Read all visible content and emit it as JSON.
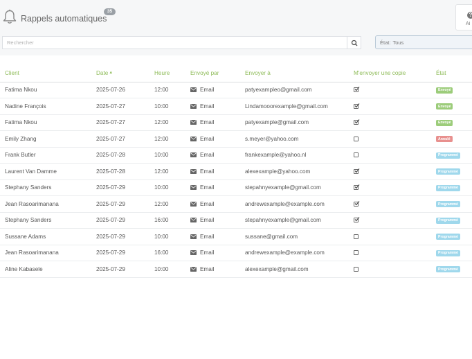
{
  "header": {
    "title": "Rappels automatiques",
    "count": "35",
    "help_label": "Ai"
  },
  "toolbar": {
    "search_placeholder": "Rechercher",
    "state_filter_label": "État:",
    "state_filter_value": "Tous"
  },
  "table": {
    "columns": {
      "client": "Client",
      "date": "Date",
      "date_sort": "▲",
      "heure": "Heure",
      "envoye_par": "Envoyé par",
      "envoyer_a": "Envoyer à",
      "copie": "M'envoyer une copie",
      "etat": "État"
    },
    "rows": [
      {
        "client": "Fatima Nkou",
        "date": "2025-07-26",
        "heure": "12:00",
        "method": "Email",
        "email": "patyexampleo@gmail.com",
        "copy": true,
        "status": "Envoyé",
        "status_color": "#9ccc7a"
      },
      {
        "client": "Nadine François",
        "date": "2025-07-27",
        "heure": "10:00",
        "method": "Email",
        "email": "Lindamooorexample@gmail.com",
        "copy": true,
        "status": "Envoyé",
        "status_color": "#9ccc7a"
      },
      {
        "client": "Fatima Nkou",
        "date": "2025-07-27",
        "heure": "12:00",
        "method": "Email",
        "email": "patyexample@gmail.com",
        "copy": true,
        "status": "Envoyé",
        "status_color": "#9ccc7a"
      },
      {
        "client": "Emily Zhang",
        "date": "2025-07-27",
        "heure": "12:00",
        "method": "Email",
        "email": "s.meyer@yahoo.com",
        "copy": false,
        "status": "Annulé",
        "status_color": "#e8908e"
      },
      {
        "client": "Frank Butler",
        "date": "2025-07-28",
        "heure": "10:00",
        "method": "Email",
        "email": "frankexample@yahoo.nl",
        "copy": false,
        "status": "Programmé",
        "status_color": "#9fd8ec"
      },
      {
        "client": "Laurent Van Damme",
        "date": "2025-07-28",
        "heure": "12:00",
        "method": "Email",
        "email": "alexexample@yahoo.com",
        "copy": true,
        "status": "Programmé",
        "status_color": "#9fd8ec"
      },
      {
        "client": "Stephany Sanders",
        "date": "2025-07-29",
        "heure": "10:00",
        "method": "Email",
        "email": "stepahnyexample@gmail.com",
        "copy": true,
        "status": "Programmé",
        "status_color": "#9fd8ec"
      },
      {
        "client": "Jean Rasoarimanana",
        "date": "2025-07-29",
        "heure": "12:00",
        "method": "Email",
        "email": "andrewexample@example.com",
        "copy": true,
        "status": "Programmé",
        "status_color": "#9fd8ec"
      },
      {
        "client": "Stephany Sanders",
        "date": "2025-07-29",
        "heure": "16:00",
        "method": "Email",
        "email": "stepahnyexample@gmail.com",
        "copy": true,
        "status": "Programmé",
        "status_color": "#9fd8ec"
      },
      {
        "client": "Sussane Adams",
        "date": "2025-07-29",
        "heure": "10:00",
        "method": "Email",
        "email": "sussane@gmail.com",
        "copy": false,
        "status": "Programmé",
        "status_color": "#9fd8ec"
      },
      {
        "client": "Jean Rasoarimanana",
        "date": "2025-07-29",
        "heure": "16:00",
        "method": "Email",
        "email": "andrewexample@example.com",
        "copy": false,
        "status": "Programmé",
        "status_color": "#9fd8ec"
      },
      {
        "client": "Aline Kabasele",
        "date": "2025-07-29",
        "heure": "10:00",
        "method": "Email",
        "email": "alexexample@gmail.com",
        "copy": false,
        "status": "Programmé",
        "status_color": "#9fd8ec"
      }
    ]
  }
}
